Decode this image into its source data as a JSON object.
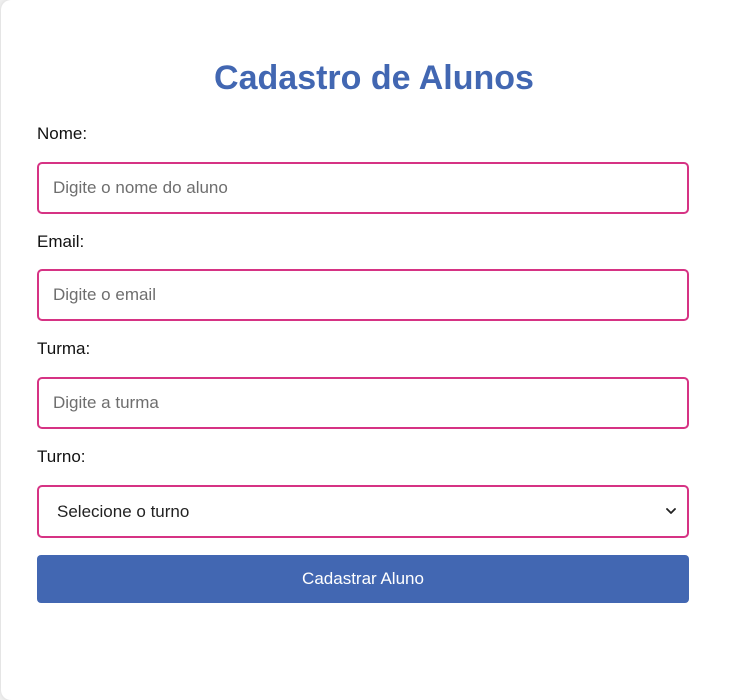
{
  "form": {
    "title": "Cadastro de Alunos",
    "fields": [
      {
        "label": "Nome:",
        "placeholder": "Digite o nome do aluno",
        "value": ""
      },
      {
        "label": "Email:",
        "placeholder": "Digite o email",
        "value": ""
      },
      {
        "label": "Turma:",
        "placeholder": "Digite a turma",
        "value": ""
      }
    ],
    "turno": {
      "label": "Turno:",
      "selected": "Selecione o turno",
      "icon": "chevron-down-icon"
    },
    "submit_label": "Cadastrar Aluno"
  },
  "colors": {
    "accent": "#4267b2",
    "input_border": "#d63384"
  }
}
